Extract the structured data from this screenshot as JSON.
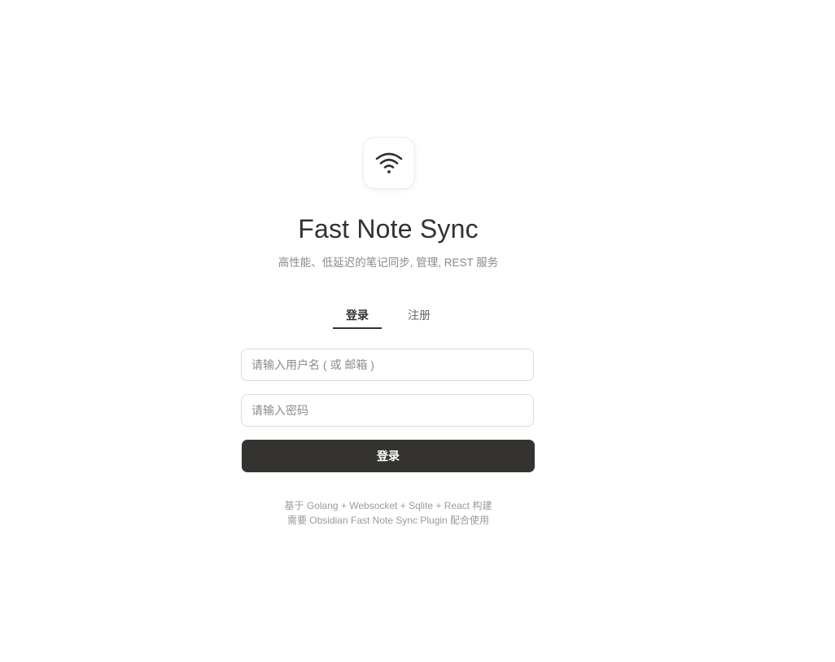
{
  "app": {
    "logo_icon": "wifi-icon",
    "title": "Fast Note Sync",
    "subtitle": "高性能、低延迟的笔记同步, 管理, REST 服务"
  },
  "tabs": [
    {
      "label": "登录",
      "active": true
    },
    {
      "label": "注册",
      "active": false
    }
  ],
  "form": {
    "username_placeholder": "请输入用户名 ( 或 邮箱 )",
    "username_value": "",
    "password_placeholder": "请输入密码",
    "password_value": "",
    "submit_label": "登录"
  },
  "footer": {
    "line1": "基于 Golang + Websocket + Sqlite + React 构建",
    "line2": "需要 Obsidian Fast Note Sync Plugin 配合使用"
  },
  "colors": {
    "button_bg": "#353330",
    "text_primary": "#333230",
    "text_muted": "#8a8a8a"
  }
}
